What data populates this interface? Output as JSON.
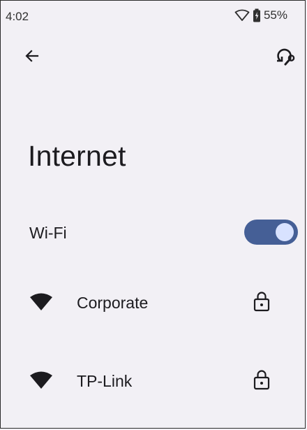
{
  "status_bar": {
    "time": "4:02",
    "battery": "55%"
  },
  "header": {
    "back_icon": "arrow-left-icon",
    "action_icon": "refresh-wrench-icon"
  },
  "page": {
    "title": "Internet"
  },
  "wifi": {
    "label": "Wi-Fi",
    "enabled": true,
    "toggle_track_color": "#455f96",
    "toggle_thumb_color": "#d8e2ff"
  },
  "networks": [
    {
      "name": "Corporate",
      "signal_icon": "wifi-full-icon",
      "secured_icon": "lock-icon"
    },
    {
      "name": "TP-Link",
      "signal_icon": "wifi-full-icon",
      "secured_icon": "lock-icon"
    }
  ]
}
